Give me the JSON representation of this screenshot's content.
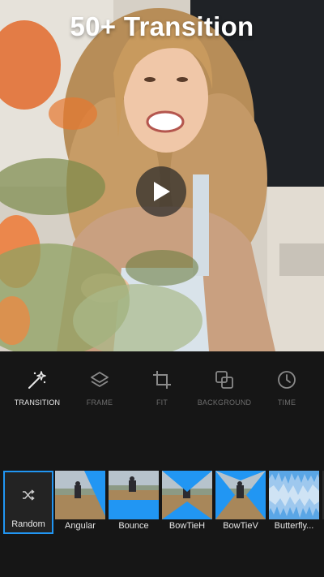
{
  "preview": {
    "headline": "50+ Transition",
    "play_icon": "play-icon"
  },
  "toolbar": {
    "tools": [
      {
        "label": "TRANSITION",
        "icon": "magic-wand-icon",
        "active": true
      },
      {
        "label": "FRAME",
        "icon": "layers-icon",
        "active": false
      },
      {
        "label": "FIT",
        "icon": "crop-icon",
        "active": false
      },
      {
        "label": "BACKGROUND",
        "icon": "overlap-squares-icon",
        "active": false
      },
      {
        "label": "TIME",
        "icon": "clock-icon",
        "active": false
      }
    ]
  },
  "transitions": {
    "selected": "Random",
    "items": [
      {
        "label": "Random",
        "icon": "shuffle-icon"
      },
      {
        "label": "Angular"
      },
      {
        "label": "Bounce"
      },
      {
        "label": "BowTieH"
      },
      {
        "label": "BowTieV"
      },
      {
        "label": "Butterfly..."
      }
    ]
  },
  "colors": {
    "accent": "#2196f3",
    "background": "#161616",
    "label_inactive": "#6d6d6d",
    "label_active": "#e8e8e8"
  }
}
